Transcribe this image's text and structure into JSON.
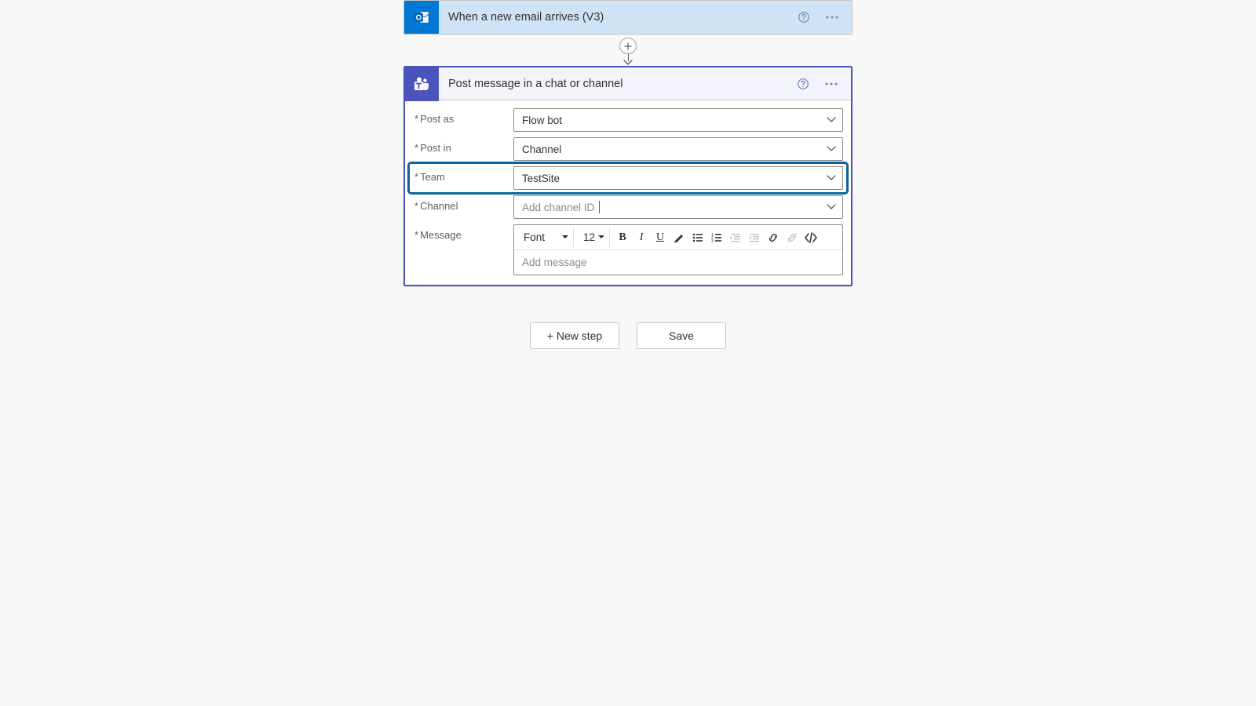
{
  "trigger": {
    "title": "When a new email arrives (V3)"
  },
  "action": {
    "title": "Post message in a chat or channel",
    "fields": {
      "post_as": {
        "label": "Post as",
        "value": "Flow bot"
      },
      "post_in": {
        "label": "Post in",
        "value": "Channel"
      },
      "team": {
        "label": "Team",
        "value": "TestSite"
      },
      "channel": {
        "label": "Channel",
        "placeholder": "Add channel ID"
      },
      "message": {
        "label": "Message",
        "placeholder": "Add message"
      }
    },
    "toolbar": {
      "font_label": "Font",
      "font_size": "12"
    }
  },
  "footer": {
    "new_step": "+ New step",
    "save": "Save"
  }
}
